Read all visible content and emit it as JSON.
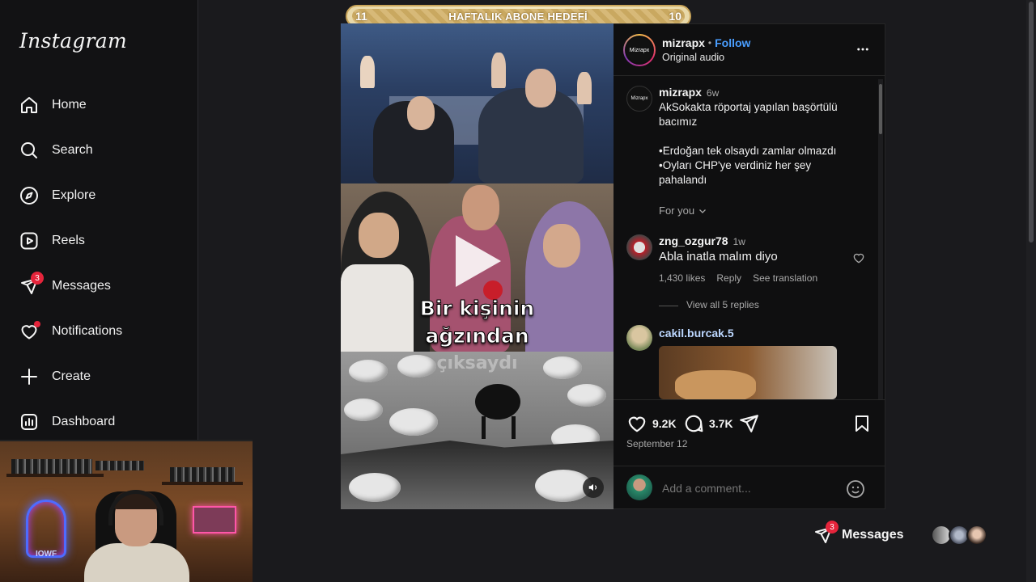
{
  "sidebar": {
    "logo": "Instagram",
    "items": [
      {
        "label": "Home",
        "icon": "home-icon"
      },
      {
        "label": "Search",
        "icon": "search-icon"
      },
      {
        "label": "Explore",
        "icon": "compass-icon"
      },
      {
        "label": "Reels",
        "icon": "reels-icon"
      },
      {
        "label": "Messages",
        "icon": "send-icon",
        "badge": "3"
      },
      {
        "label": "Notifications",
        "icon": "heart-icon"
      },
      {
        "label": "Create",
        "icon": "plus-icon"
      },
      {
        "label": "Dashboard",
        "icon": "dashboard-icon"
      }
    ]
  },
  "banner": {
    "left_num": "11",
    "title": "HAFTALIK ABONE HEDEFİ",
    "right_num": "10"
  },
  "webcam": {
    "neon_text": "IOWF"
  },
  "video": {
    "caption_line1": "Bir kişinin",
    "caption_line2": "ağzından",
    "caption_line3": "çıksaydı"
  },
  "post": {
    "author": "mizrapx",
    "dot": "•",
    "follow": "Follow",
    "audio": "Original audio",
    "avatar_text": "Mizrapx",
    "caption_author": "mizrapx",
    "caption_time": "6w",
    "caption_l1": "AkSokakta röportaj yapılan başörtülü",
    "caption_l2": "bacımız",
    "caption_l3": "•Erdoğan tek olsaydı zamlar olmazdı",
    "caption_l4": "•Oyları CHP'ye verdiniz her şey",
    "caption_l5": "pahalandı",
    "for_you": "For you"
  },
  "comments": [
    {
      "user": "zng_ozgur78",
      "time": "1w",
      "text": "Abla inatla malım diyo",
      "likes": "1,430 likes",
      "reply": "Reply",
      "translate": "See translation",
      "replies": "View all 5 replies"
    },
    {
      "user": "cakil.burcak.5"
    }
  ],
  "actions": {
    "likes": "9.2K",
    "comments": "3.7K",
    "date": "September 12"
  },
  "add_comment": {
    "placeholder": "Add a comment..."
  },
  "messages_pill": {
    "label": "Messages",
    "badge": "3"
  },
  "colors": {
    "accent_blue": "#4a9eff",
    "badge_red": "#e5243b",
    "bg": "#1a1a1d"
  }
}
